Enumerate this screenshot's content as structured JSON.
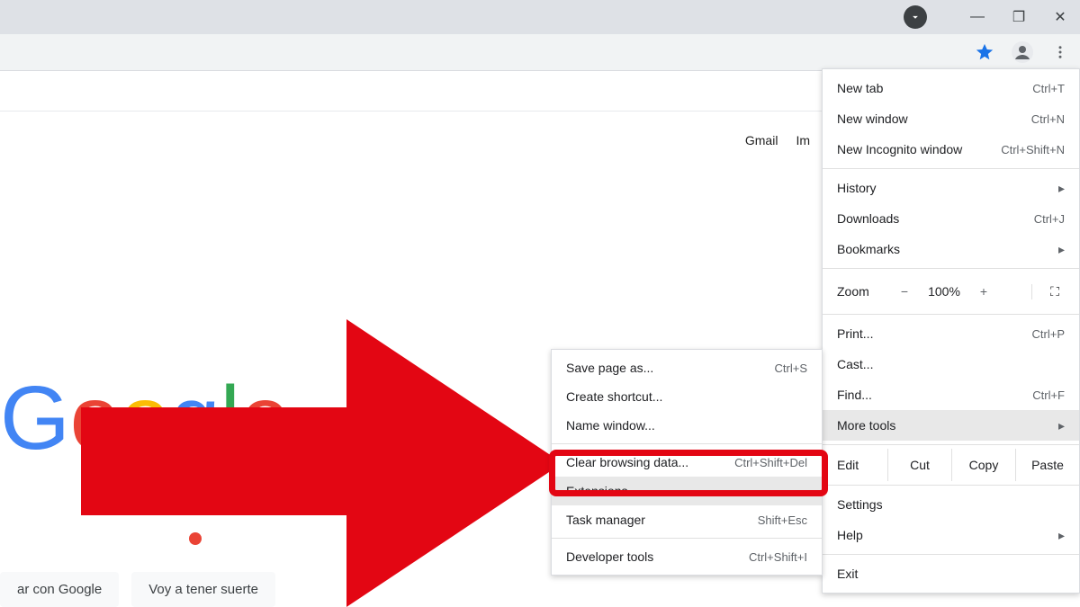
{
  "window": {
    "close": "✕",
    "maximize": "❐",
    "minimize": "—"
  },
  "page": {
    "links": {
      "gmail": "Gmail",
      "images": "Im"
    },
    "logo": {
      "g1": "G",
      "o1": "o",
      "o2": "o",
      "g2": "g",
      "l": "l",
      "e": "e"
    },
    "buttons": {
      "search": "ar con Google",
      "lucky": "Voy a tener suerte"
    }
  },
  "menu": {
    "newtab": {
      "label": "New tab",
      "shortcut": "Ctrl+T"
    },
    "newwin": {
      "label": "New window",
      "shortcut": "Ctrl+N"
    },
    "incognito": {
      "label": "New Incognito window",
      "shortcut": "Ctrl+Shift+N"
    },
    "history": {
      "label": "History"
    },
    "downloads": {
      "label": "Downloads",
      "shortcut": "Ctrl+J"
    },
    "bookmarks": {
      "label": "Bookmarks"
    },
    "zoom": {
      "label": "Zoom",
      "minus": "−",
      "value": "100%",
      "plus": "+"
    },
    "print": {
      "label": "Print...",
      "shortcut": "Ctrl+P"
    },
    "cast": {
      "label": "Cast..."
    },
    "find": {
      "label": "Find...",
      "shortcut": "Ctrl+F"
    },
    "moretools": {
      "label": "More tools"
    },
    "edit": {
      "label": "Edit",
      "cut": "Cut",
      "copy": "Copy",
      "paste": "Paste"
    },
    "settings": {
      "label": "Settings"
    },
    "help": {
      "label": "Help"
    },
    "exit": {
      "label": "Exit"
    }
  },
  "submenu": {
    "savepage": {
      "label": "Save page as...",
      "shortcut": "Ctrl+S"
    },
    "shortcut": {
      "label": "Create shortcut..."
    },
    "namewin": {
      "label": "Name window..."
    },
    "clear": {
      "label": "Clear browsing data...",
      "shortcut": "Ctrl+Shift+Del"
    },
    "extensions": {
      "label": "Extensions"
    },
    "taskmgr": {
      "label": "Task manager",
      "shortcut": "Shift+Esc"
    },
    "devtools": {
      "label": "Developer tools",
      "shortcut": "Ctrl+Shift+I"
    }
  }
}
